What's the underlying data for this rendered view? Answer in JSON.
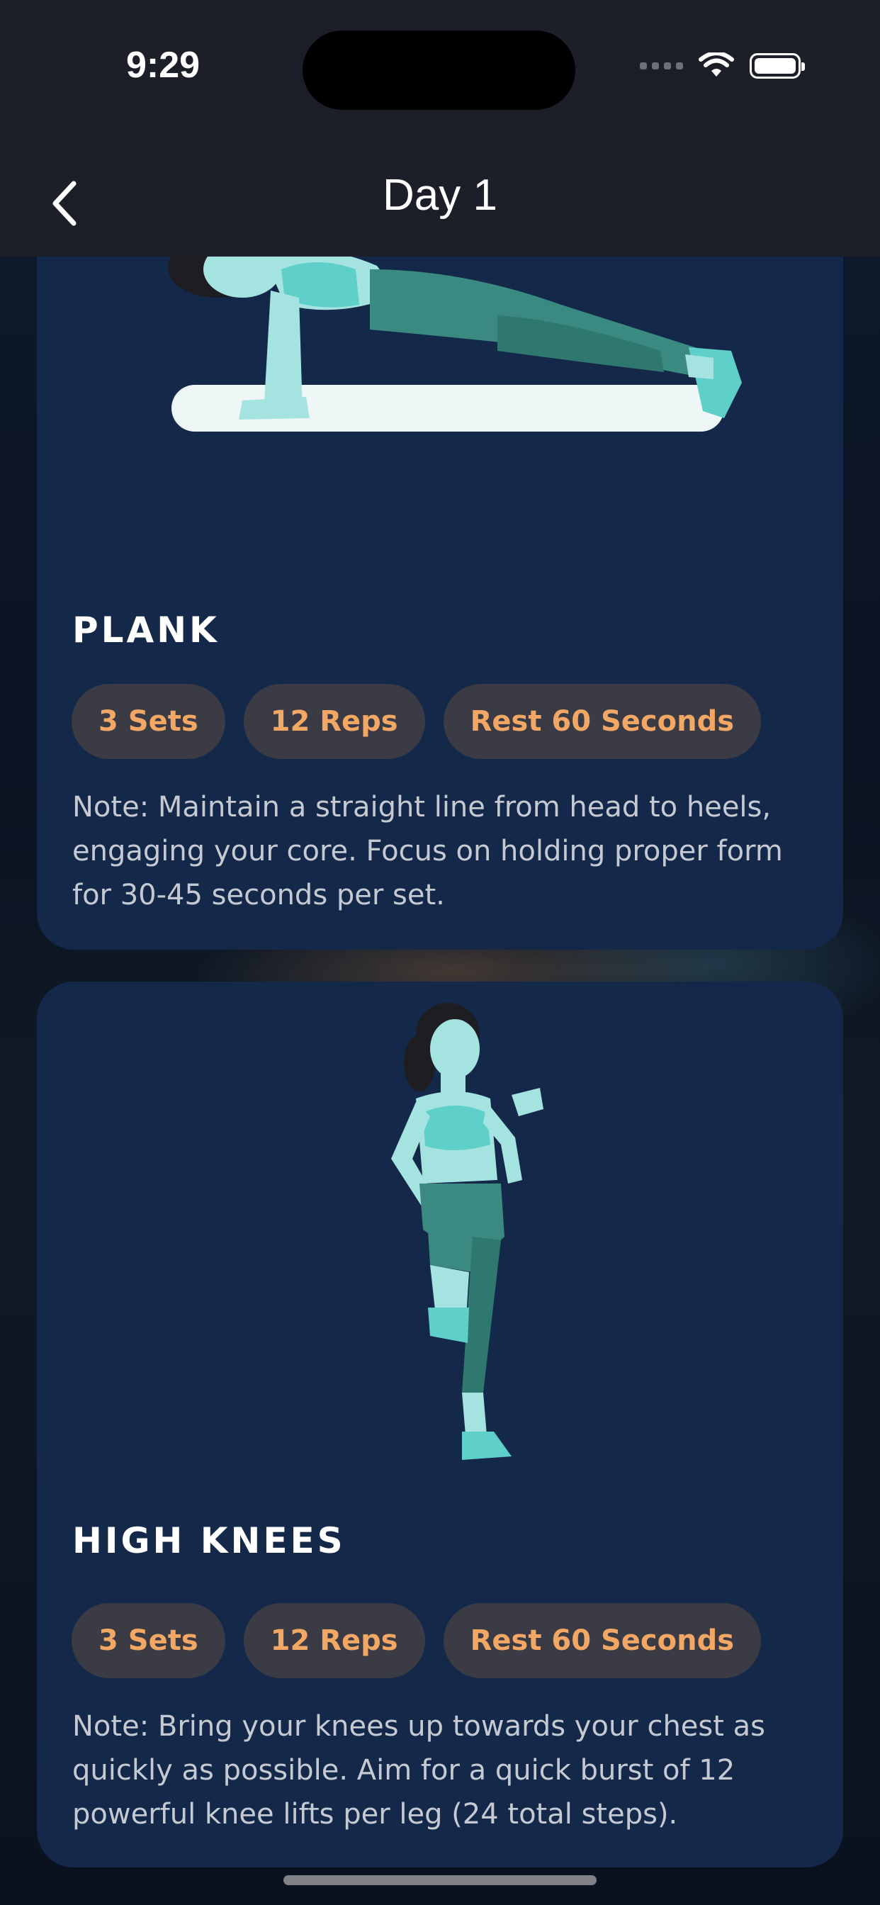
{
  "status_bar": {
    "time": "9:29",
    "icons": [
      "signal-icon",
      "wifi-icon",
      "battery-icon"
    ]
  },
  "nav": {
    "title": "Day 1",
    "back_icon": "chevron-left-icon"
  },
  "exercises": [
    {
      "name": "PLANK",
      "sets": "3 Sets",
      "reps": "12 Reps",
      "rest": "Rest 60 Seconds",
      "note": "Note: Maintain a straight line from head to heels, engaging your core. Focus on holding proper form for 30-45 seconds per set."
    },
    {
      "name": "HIGH KNEES",
      "sets": "3 Sets",
      "reps": "12 Reps",
      "rest": "Rest 60 Seconds",
      "note": "Note: Bring your knees up towards your chest as quickly as possible. Aim for a quick burst of 12 powerful knee lifts per leg (24 total steps)."
    }
  ],
  "colors": {
    "card_bg": "#14284a",
    "chip_bg": "#3a3b44",
    "chip_text": "#f2a864",
    "bar_bg": "#1c1f27",
    "accent_teal": "#5ad0cc"
  }
}
